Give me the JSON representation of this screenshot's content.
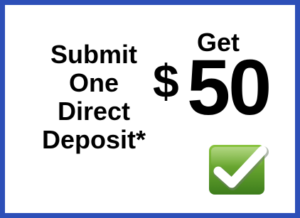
{
  "promo": {
    "lines": [
      "Submit",
      "One",
      "Direct",
      "Deposit*"
    ],
    "get_label": "Get",
    "currency_symbol": "$",
    "amount": "50"
  },
  "colors": {
    "border": "#2d4fb8",
    "check_badge_top": "#8ac43f",
    "check_badge_bottom": "#3d7d1c",
    "checkmark": "#ffffff"
  },
  "icons": {
    "badge": "checkmark-icon"
  }
}
